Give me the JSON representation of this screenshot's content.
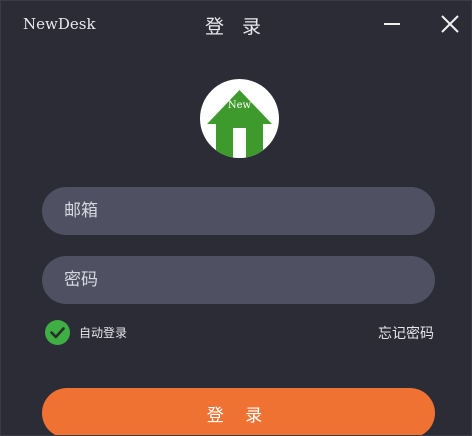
{
  "window": {
    "app_name": "NewDesk",
    "title": "登 录",
    "minimize_icon": "minimize-icon",
    "close_icon": "close-icon"
  },
  "logo": {
    "text": "New",
    "icon": "house-icon",
    "color": "#3e9a2c"
  },
  "form": {
    "email_placeholder": "邮箱",
    "email_value": "",
    "password_placeholder": "密码",
    "password_value": "",
    "remember_label": "自动登录",
    "remember_checked": true,
    "forgot_label": "忘记密码",
    "submit_label": "登 录"
  },
  "colors": {
    "background": "#2b2c36",
    "input_bg": "#4f5061",
    "accent": "#ef7233",
    "check": "#3fae45"
  }
}
